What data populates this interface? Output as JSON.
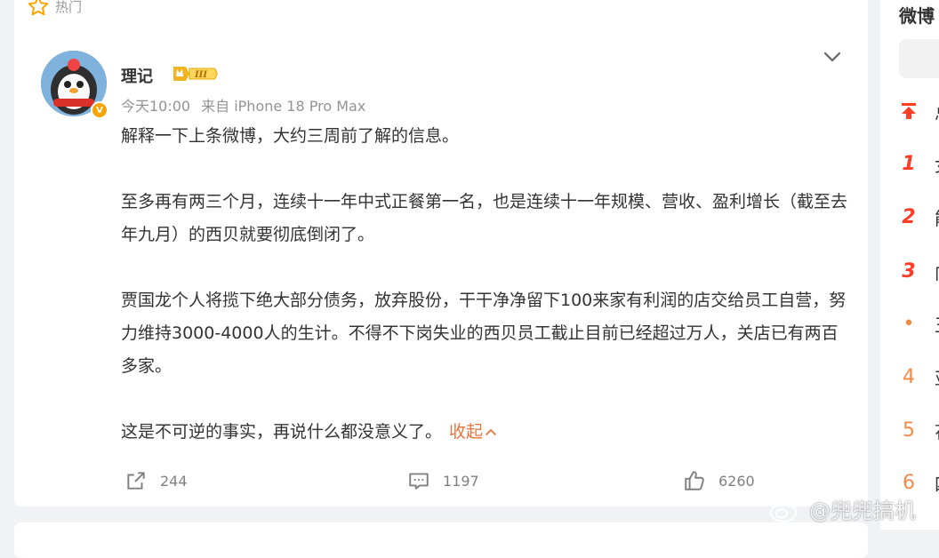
{
  "feed": {
    "hot_label": "热门",
    "post": {
      "username": "理记",
      "level_badge": "III",
      "verified_mark": "V",
      "time": "今天10:00",
      "source": "来自 iPhone 18 Pro Max",
      "paragraphs": [
        "解释一下上条微博，大约三周前了解的信息。",
        "至多再有两三个月，连续十一年中式正餐第一名，也是连续十一年规模、营收、盈利增长（截至去年九月）的西贝就要彻底倒闭了。",
        "贾国龙个人将揽下绝大部分债务，放弃股份，干干净净留下100来家有利润的店交给员工自营，努力维持3000-4000人的生计。不得不下岗失业的西贝员工截止目前已经超过万人，关店已有两百多家。",
        "这是不可逆的事实，再说什么都没意义了。"
      ],
      "collapse_label": "收起",
      "actions": {
        "repost_count": "244",
        "comment_count": "1197",
        "like_count": "6260"
      }
    }
  },
  "sidebar": {
    "title": "微博",
    "items": [
      {
        "rank": "",
        "icon": "pin-up-icon",
        "text": "总"
      },
      {
        "rank": "1",
        "text": "女"
      },
      {
        "rank": "2",
        "text": "能"
      },
      {
        "rank": "3",
        "text": "向"
      },
      {
        "rank": "•",
        "text": "王"
      },
      {
        "rank": "4",
        "text": "亚"
      },
      {
        "rank": "5",
        "text": "花"
      },
      {
        "rank": "6",
        "text": "四"
      }
    ]
  },
  "watermark": {
    "text": "@兜兜搞机"
  },
  "colors": {
    "accent": "#eb7340",
    "hot_red": "#ff3c27",
    "rank_orange": "#f48a4a",
    "muted": "#939393"
  }
}
